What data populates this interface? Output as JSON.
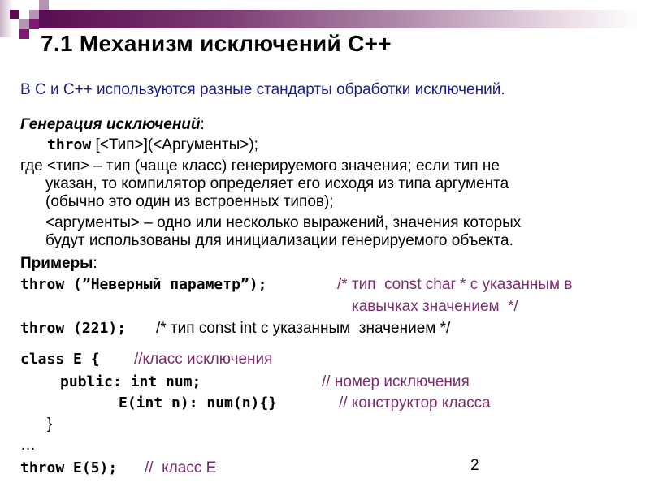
{
  "slide": {
    "title": "7.1 Механизм исключений С++",
    "intro": "В С и С++ используются разные стандарты обработки исключений.",
    "generation_heading": "Генерация исключений",
    "colon": ":",
    "throw_keyword": "throw",
    "throw_syntax": " [<Тип>](<Аргументы>);",
    "where_line1": "где <тип> – тип (чаще класс) генерируемого значения; если тип не",
    "where_line2": "указан, то компилятор определяет его исходя из типа аргумента",
    "where_line3": "(обычно это один из встроенных типов);",
    "args_line1": "<аргументы> – одно или несколько выражений, значения которых",
    "args_line2": "будут использованы для инициализации генерируемого объекта.",
    "examples_heading": "Примеры",
    "ex1_code": "throw (”Неверный параметр”);",
    "ex1_comment1": "/* тип  const char * с указанным в",
    "ex1_comment2": "кавычках значением  */",
    "ex2_code": "throw (221);",
    "ex2_comment": "/* тип const int с указанным  значением */",
    "class_code": "class E {",
    "class_comment": "//класс исключения",
    "public_code": "public: int num;",
    "public_comment": "// номер исключения",
    "ctor_code": "E(int n): num(n){}",
    "ctor_comment": "// конструктор класса",
    "close_brace": "}",
    "ellipsis": "…",
    "ex3_code": "throw E(5);",
    "ex3_comment": "//  класс Е",
    "page_number": "2"
  },
  "colors": {
    "accent": "#5a0d52",
    "intro_text": "#1a1a8c",
    "comment": "#7b2c6e"
  }
}
